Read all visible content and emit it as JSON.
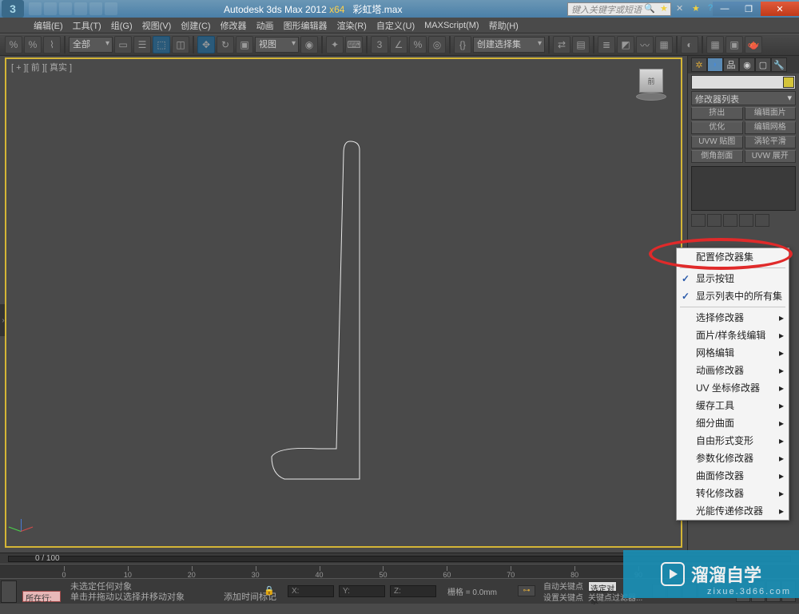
{
  "app": {
    "name": "Autodesk 3ds Max  2012 ",
    "version": "x64",
    "file": "彩虹塔.max"
  },
  "search_placeholder": "键入关键字或短语",
  "menu": {
    "edit": "编辑(E)",
    "tools": "工具(T)",
    "group": "组(G)",
    "views": "视图(V)",
    "create": "创建(C)",
    "modifiers": "修改器",
    "anim": "动画",
    "graph": "图形编辑器",
    "render": "渲染(R)",
    "custom": "自定义(U)",
    "maxscript": "MAXScript(M)",
    "help": "帮助(H)"
  },
  "toolbar": {
    "sel_filter": "全部",
    "view": "视图",
    "namedset": "创建选择集"
  },
  "viewport": {
    "label": "[ + ][ 前 ][ 真实 ]"
  },
  "panel": {
    "modlist_hdr": "修改器列表",
    "btns": {
      "b1": "挤出",
      "b2": "编辑面片",
      "b3": "优化",
      "b4": "编辑网格",
      "b5": "UVW 贴图",
      "b6": "涡轮平滑",
      "b7": "倒角剖面",
      "b8": "UVW 展开"
    }
  },
  "ctxmenu": {
    "configure": "配置修改器集",
    "show_btns": "显示按钮",
    "show_all": "显示列表中的所有集",
    "sel_mod": "选择修改器",
    "patch_spline": "面片/样条线编辑",
    "mesh_edit": "网格编辑",
    "anim_mod": "动画修改器",
    "uv_mod": "UV 坐标修改器",
    "cache": "缓存工具",
    "subdiv": "细分曲面",
    "ffd": "自由形式变形",
    "param": "参数化修改器",
    "surf": "曲面修改器",
    "convert": "转化修改器",
    "radio": "光能传递修改器"
  },
  "timeline": {
    "frame": "0 / 100"
  },
  "status": {
    "line1": "未选定任何对象",
    "line2": "单击并拖动以选择并移动对象",
    "coord_x": "X:",
    "coord_y": "Y:",
    "coord_z": "Z:",
    "grid": "栅格 = 0.0mm",
    "autokey": "自动关键点",
    "setkey": "设置关键点",
    "selset": "选定对象",
    "keyfilter": "关键点过滤器...",
    "addtime": "添加时间标记",
    "script_label": "所在行:"
  },
  "watermark": {
    "text": "溜溜自学",
    "sub": "zixue.3d66.com"
  }
}
